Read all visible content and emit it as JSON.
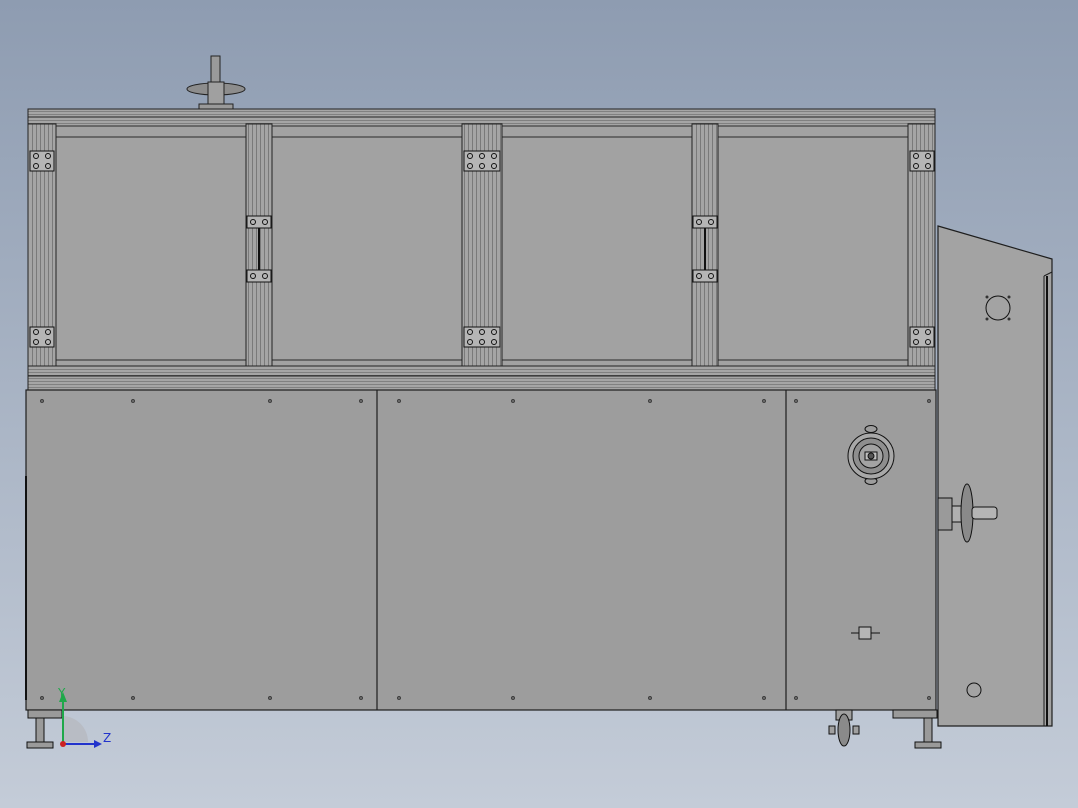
{
  "viewport": {
    "background_top": "#8e9cb1",
    "background_bottom": "#c4ccd8",
    "panel_fill": "#9d9d9d",
    "edge_color": "#1e1e1e"
  },
  "triad": {
    "y_label": "Y",
    "z_label": "Z",
    "y_color": "#1fa84a",
    "z_color": "#2233cc",
    "origin_color": "#cc2222"
  }
}
